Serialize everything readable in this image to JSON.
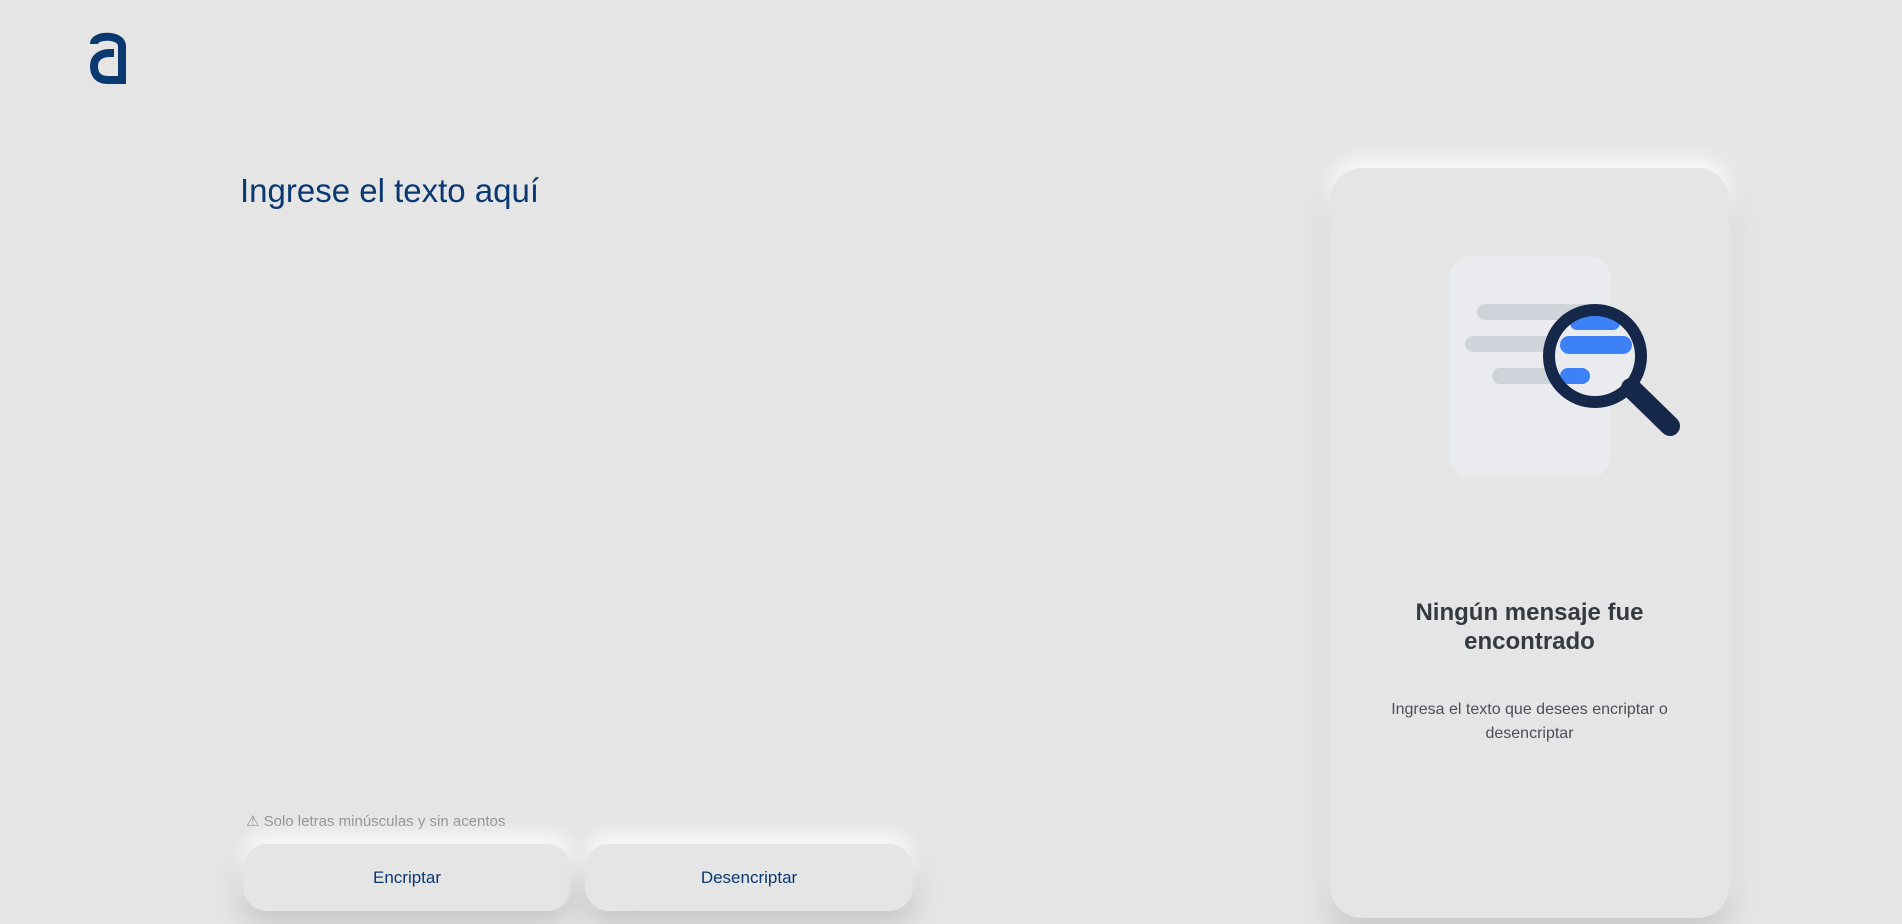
{
  "logo": {
    "icon": "alura-logo-icon",
    "color": "#0a3871"
  },
  "input": {
    "placeholder": "Ingrese el texto aquí",
    "value": ""
  },
  "hint": {
    "icon": "warning-icon",
    "text": "⚠ Solo letras minúsculas y sin acentos"
  },
  "buttons": {
    "encrypt_label": "Encriptar",
    "decrypt_label": "Desencriptar"
  },
  "result_panel": {
    "illustration": "document-search-icon",
    "title": "Ningún mensaje fue encontrado",
    "description": "Ingresa el texto que desees encriptar o desencriptar"
  },
  "colors": {
    "background": "#e5e5e5",
    "accent": "#0a3871",
    "highlight": "#3c82f6"
  }
}
